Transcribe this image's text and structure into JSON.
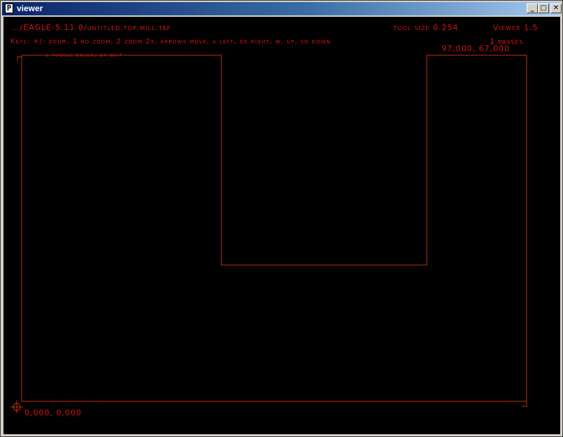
{
  "window": {
    "title": "viewer",
    "icon_glyph": "P",
    "buttons": {
      "minimize": "_",
      "maximize": "□",
      "close": "✕"
    }
  },
  "hud": {
    "file_path": ".../EAGLE-5.11.0/untitled.top.mill.tap",
    "tool_size": "tool size  0.254",
    "viewer_version": "Viewer 1.5",
    "keys_help": "Keys: +/- zoom, 1 no zoom, 2 zoom 2x, arrows move, a left, de right, w, up, sd down",
    "keys_help_line2": "c toggle color, qx quit",
    "passes": "1 passes",
    "max_coord": "97,000,  67,000",
    "origin_coord": "0,000,  0,000"
  },
  "colors": {
    "hud_text": "#e01010",
    "toolpath": "#c0300a",
    "background": "#000000",
    "titlebar_start": "#0a246a",
    "titlebar_end": "#a6caf0"
  },
  "icons": {
    "origin_marker": "crosshair-icon",
    "app": "app-icon"
  }
}
